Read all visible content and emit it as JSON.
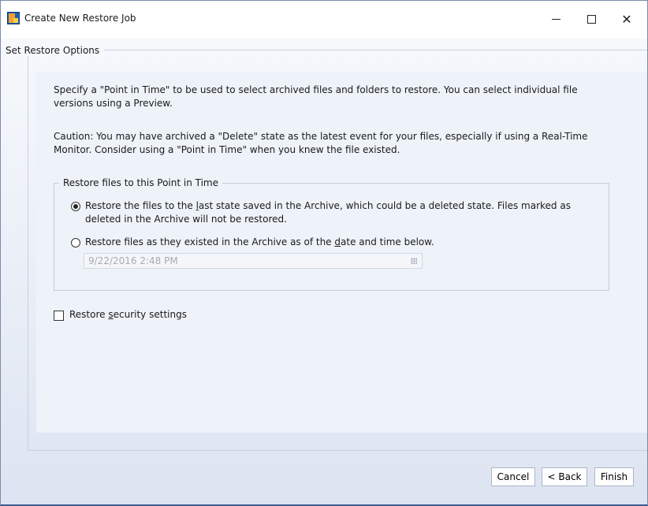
{
  "window": {
    "title": "Create New Restore Job",
    "minimize_glyph": "–",
    "close_glyph": "✕"
  },
  "options": {
    "legend": "Set Restore Options",
    "intro_text": "Specify a \"Point in Time\" to be used to select archived files and folders to restore. You can select individual file versions using a Preview.",
    "caution_text": "Caution: You may have archived a \"Delete\" state as the latest event for your files, especially if using a Real-Time Monitor. Consider using a \"Point in Time\" when you knew the file existed."
  },
  "point_in_time": {
    "legend": "Restore files to this Point in Time",
    "option_last_state": {
      "before": "Restore the files to the ",
      "accel": "l",
      "after": "ast state saved in the Archive, which could be a deleted state. Files marked as deleted in the Archive will not be restored.",
      "selected": true
    },
    "option_date": {
      "before": "Restore files as they existed in the Archive as of the ",
      "accel": "d",
      "after": "ate and time below.",
      "selected": false
    },
    "date_value": "9/22/2016 2:48 PM"
  },
  "security": {
    "before": "Restore ",
    "accel": "s",
    "after": "ecurity settings",
    "checked": false
  },
  "buttons": {
    "cancel": "Cancel",
    "back": "< Back",
    "finish": "Finish"
  }
}
